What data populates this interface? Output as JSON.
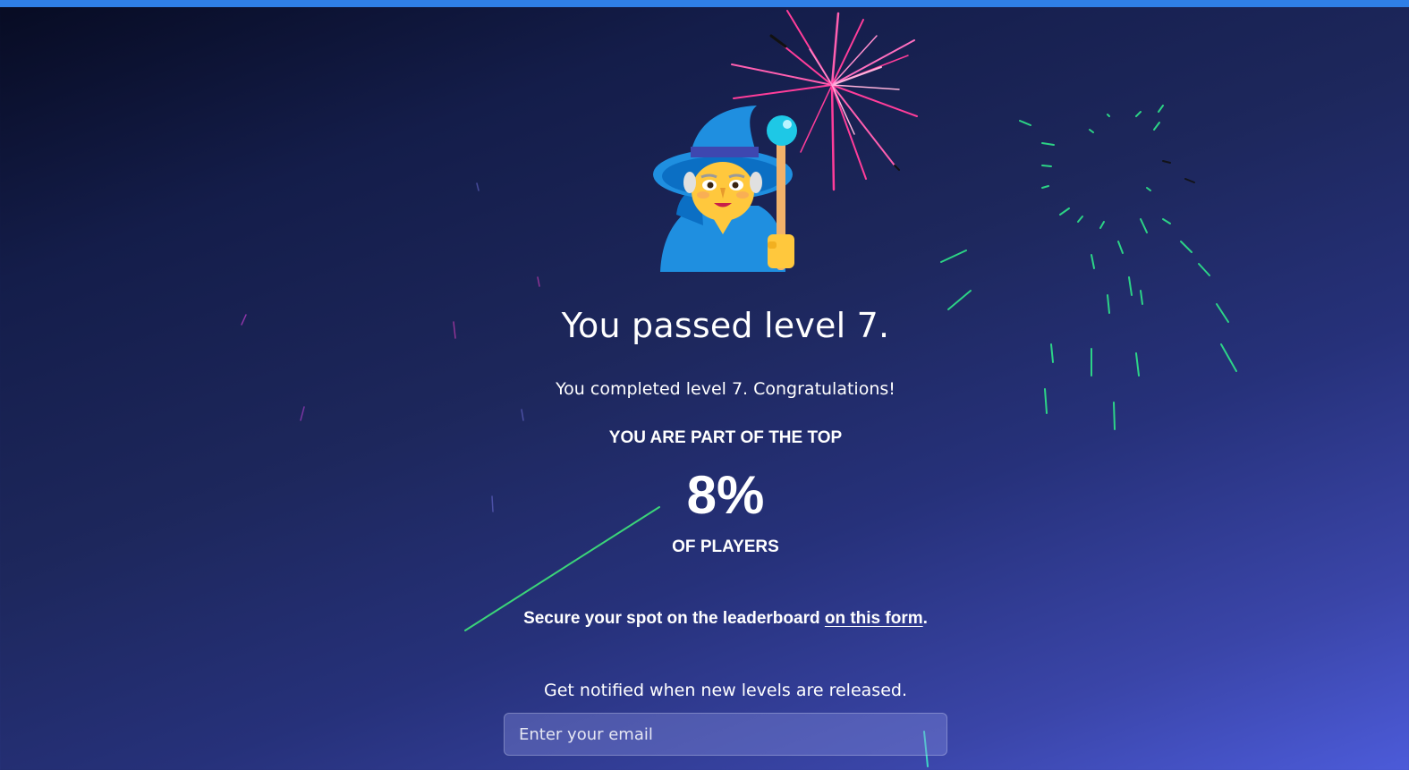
{
  "result": {
    "title": "You passed level 7.",
    "subtitle": "You completed level 7. Congratulations!",
    "rank_label": "YOU ARE PART OF THE TOP",
    "rank_value": "8%",
    "rank_suffix": "OF PLAYERS"
  },
  "leaderboard": {
    "text_before": "Secure your spot on the leaderboard ",
    "link_text": "on this form",
    "text_after": "."
  },
  "newsletter": {
    "prompt": "Get notified when new levels are released.",
    "email_placeholder": "Enter your email"
  },
  "icons": {
    "hero": "wizard-icon",
    "effects": [
      "firework-burst-pink",
      "firework-burst-green",
      "streak-lines"
    ]
  },
  "colors": {
    "accent_bar": "#2f7fe6",
    "background_start": "#070b22",
    "background_end": "#4c5bd9",
    "firework_pink": "#ff3d9a",
    "firework_green": "#2ee68a"
  }
}
